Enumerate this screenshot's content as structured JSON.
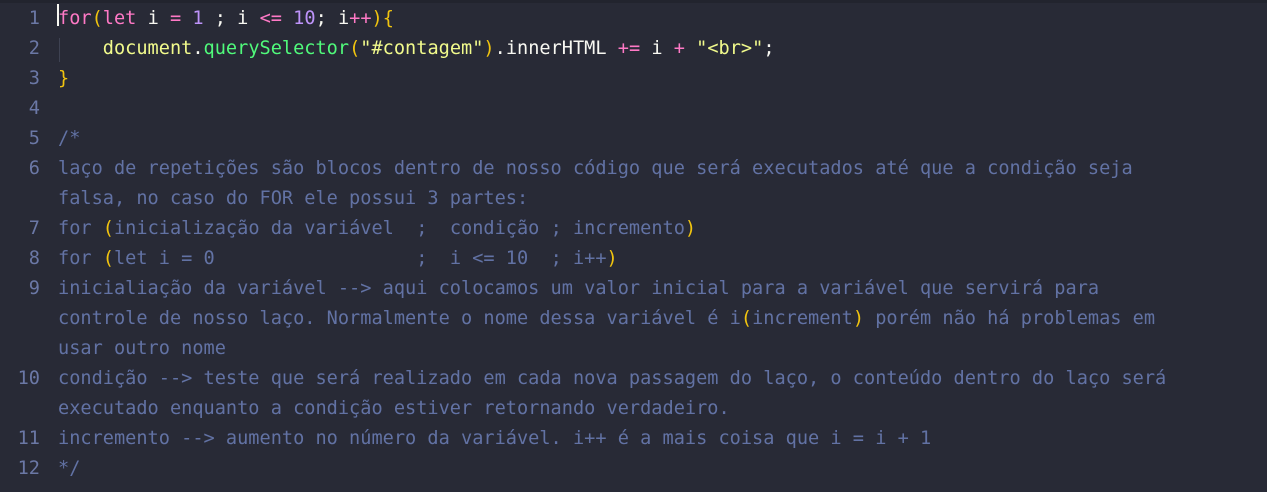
{
  "editor": {
    "lines": [
      {
        "number": "1",
        "tokens": [
          {
            "t": "for",
            "c": "kw"
          },
          {
            "t": "(",
            "c": "paren"
          },
          {
            "t": "let",
            "c": "kw"
          },
          {
            "t": " i ",
            "c": "var"
          },
          {
            "t": "=",
            "c": "op"
          },
          {
            "t": " ",
            "c": "var"
          },
          {
            "t": "1",
            "c": "num"
          },
          {
            "t": " ; i ",
            "c": "var"
          },
          {
            "t": "<=",
            "c": "op"
          },
          {
            "t": " ",
            "c": "var"
          },
          {
            "t": "10",
            "c": "num"
          },
          {
            "t": "; i",
            "c": "var"
          },
          {
            "t": "++",
            "c": "op"
          },
          {
            "t": ")",
            "c": "paren"
          },
          {
            "t": "{",
            "c": "paren"
          }
        ]
      },
      {
        "number": "2",
        "tokens": [
          {
            "t": "    ",
            "c": "var"
          },
          {
            "t": "document",
            "c": "obj"
          },
          {
            "t": ".",
            "c": "punc"
          },
          {
            "t": "querySelector",
            "c": "fn"
          },
          {
            "t": "(",
            "c": "paren"
          },
          {
            "t": "\"#contagem\"",
            "c": "str"
          },
          {
            "t": ")",
            "c": "paren"
          },
          {
            "t": ".innerHTML ",
            "c": "var"
          },
          {
            "t": "+=",
            "c": "op"
          },
          {
            "t": " i ",
            "c": "var"
          },
          {
            "t": "+",
            "c": "op"
          },
          {
            "t": " ",
            "c": "var"
          },
          {
            "t": "\"<br>\"",
            "c": "str"
          },
          {
            "t": ";",
            "c": "punc"
          }
        ]
      },
      {
        "number": "3",
        "tokens": [
          {
            "t": "}",
            "c": "paren"
          }
        ]
      },
      {
        "number": "4",
        "tokens": []
      },
      {
        "number": "5",
        "tokens": [
          {
            "t": "/*",
            "c": "cm"
          }
        ]
      },
      {
        "number": "6",
        "tokens": [
          {
            "t": "laço de repetições são blocos dentro de nosso código que será executados até que a condição seja",
            "c": "cm"
          }
        ]
      },
      {
        "number": "",
        "tokens": [
          {
            "t": "falsa, no caso do FOR ele possui 3 partes:",
            "c": "cm"
          }
        ]
      },
      {
        "number": "7",
        "tokens": [
          {
            "t": "for ",
            "c": "cm"
          },
          {
            "t": "(",
            "c": "cm-paren"
          },
          {
            "t": "inicialização da variável  ;  condição ; incremento",
            "c": "cm"
          },
          {
            "t": ")",
            "c": "cm-paren"
          }
        ]
      },
      {
        "number": "8",
        "tokens": [
          {
            "t": "for ",
            "c": "cm"
          },
          {
            "t": "(",
            "c": "cm-paren"
          },
          {
            "t": "let i = 0                  ;  i <= 10  ; i++",
            "c": "cm"
          },
          {
            "t": ")",
            "c": "cm-paren"
          }
        ]
      },
      {
        "number": "9",
        "tokens": [
          {
            "t": "inicialiação da variável --> aqui colocamos um valor inicial para a variável que servirá para",
            "c": "cm"
          }
        ]
      },
      {
        "number": "",
        "tokens": [
          {
            "t": "controle de nosso laço. Normalmente o nome dessa variável é i",
            "c": "cm"
          },
          {
            "t": "(",
            "c": "cm-paren"
          },
          {
            "t": "increment",
            "c": "cm"
          },
          {
            "t": ")",
            "c": "cm-paren"
          },
          {
            "t": " porém não há problemas em",
            "c": "cm"
          }
        ]
      },
      {
        "number": "",
        "tokens": [
          {
            "t": "usar outro nome",
            "c": "cm"
          }
        ]
      },
      {
        "number": "10",
        "tokens": [
          {
            "t": "condição --> teste que será realizado em cada nova passagem do laço, o conteúdo dentro do laço será",
            "c": "cm"
          }
        ]
      },
      {
        "number": "",
        "tokens": [
          {
            "t": "executado enquanto a condição estiver retornando verdadeiro.",
            "c": "cm"
          }
        ]
      },
      {
        "number": "11",
        "tokens": [
          {
            "t": "incremento --> aumento no número da variável. i++ é a mais coisa que i = i + 1",
            "c": "cm"
          }
        ]
      },
      {
        "number": "12",
        "tokens": [
          {
            "t": "*/",
            "c": "cm"
          }
        ]
      }
    ]
  },
  "theme": {
    "background": "#282a36",
    "gutter": "#6b78a6",
    "comment": "#6272a4",
    "keyword": "#ff79c6",
    "number": "#bd93f9",
    "string": "#f1fa8c",
    "function": "#50fa7b",
    "bracket": "#f1c40f"
  }
}
